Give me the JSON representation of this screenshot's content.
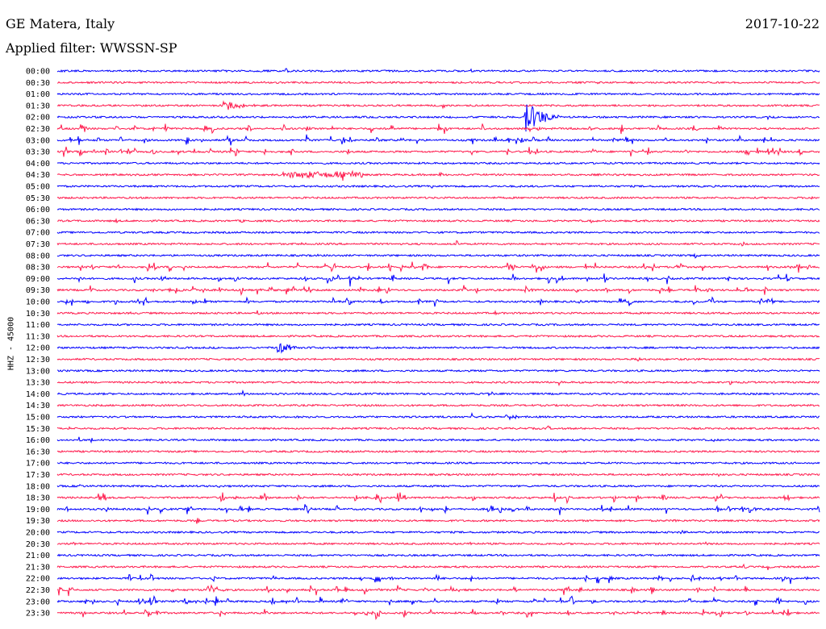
{
  "header": {
    "station": "GE Matera, Italy",
    "date": "2017-10-22",
    "filter": "Applied filter: WWSSN-SP"
  },
  "colors": {
    "trace_a": "#0000ff",
    "trace_b": "#ff1a4d"
  },
  "chart_data": {
    "type": "line",
    "title": "GE Matera, Italy",
    "ylabel": "HHZ - 45000",
    "rows": [
      "00:00",
      "00:30",
      "01:00",
      "01:30",
      "02:00",
      "02:30",
      "03:00",
      "03:30",
      "04:00",
      "04:30",
      "05:00",
      "05:30",
      "06:00",
      "06:30",
      "07:00",
      "07:30",
      "08:00",
      "08:30",
      "09:00",
      "09:30",
      "10:00",
      "10:30",
      "11:00",
      "11:30",
      "12:00",
      "12:30",
      "13:00",
      "13:30",
      "14:00",
      "14:30",
      "15:00",
      "15:30",
      "16:00",
      "16:30",
      "17:00",
      "17:30",
      "18:00",
      "18:30",
      "19:00",
      "19:30",
      "20:00",
      "20:30",
      "21:00",
      "21:30",
      "22:00",
      "22:30",
      "23:00",
      "23:30"
    ],
    "row_duration_minutes": 30,
    "colors_alternate": [
      "blue",
      "red"
    ],
    "notable_events": [
      {
        "row": "01:30",
        "minute": 6.5,
        "type": "regional"
      },
      {
        "row": "02:00",
        "minute": 18.5,
        "type": "large"
      },
      {
        "row": "04:30",
        "minute": 9.2,
        "type": "swarm"
      },
      {
        "row": "12:00",
        "minute": 8.7,
        "type": "regional"
      },
      {
        "row": "15:00",
        "minute": 17.7,
        "type": "local"
      }
    ]
  }
}
